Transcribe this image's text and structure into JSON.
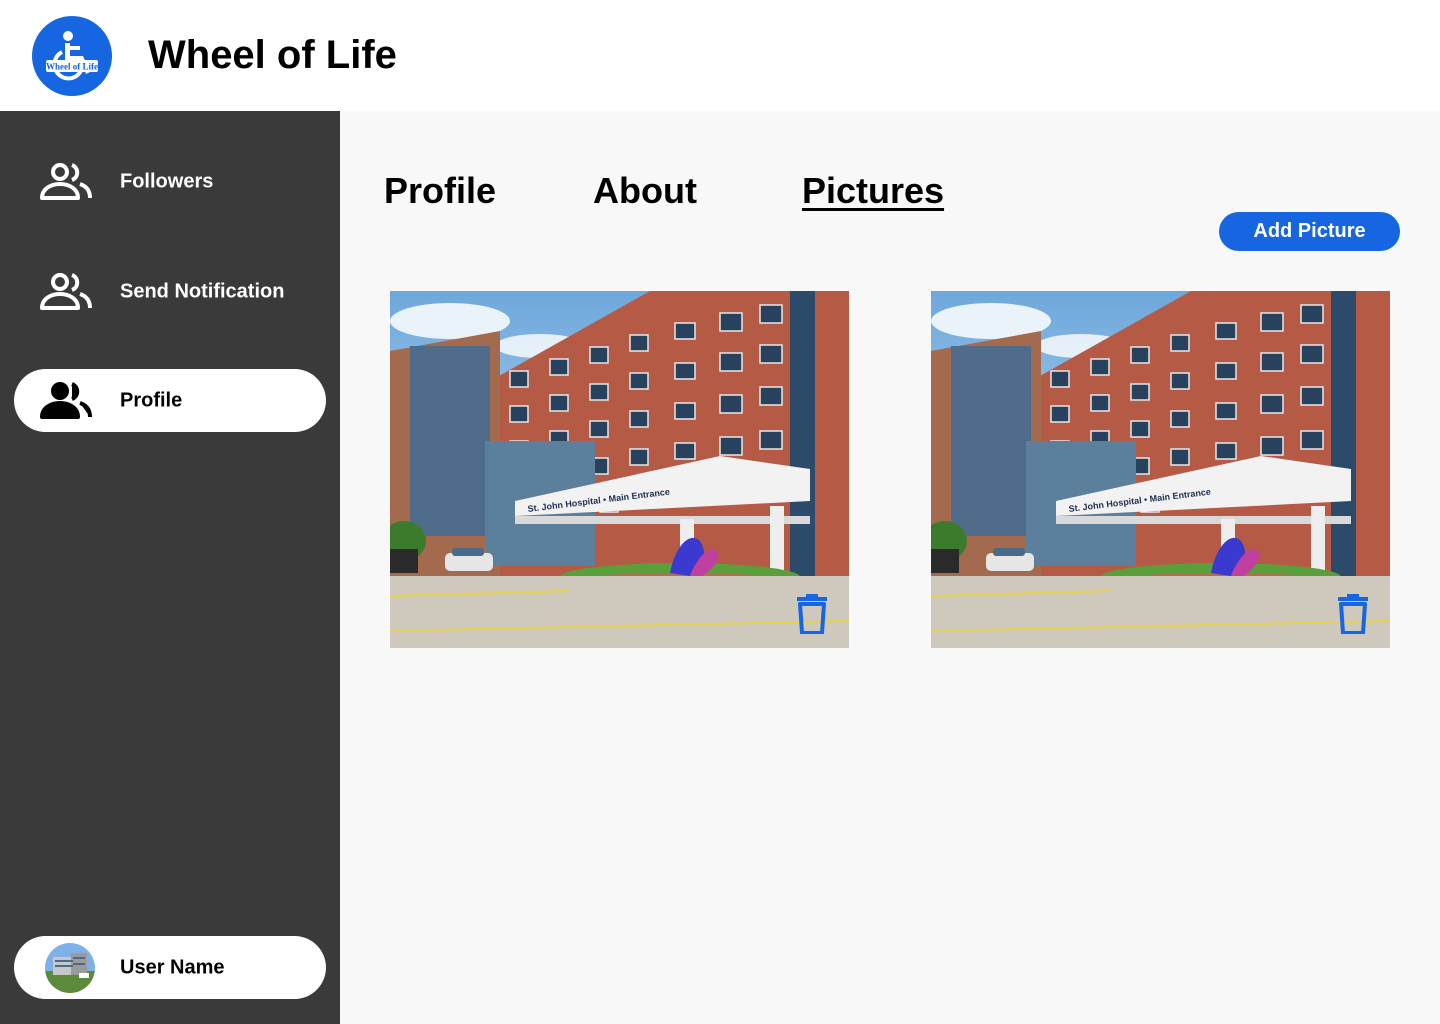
{
  "app": {
    "title": "Wheel of Life",
    "logo_text": "Wheel of Life",
    "logo_icon": "wheelchair-icon",
    "brand_color": "#1566e0"
  },
  "sidebar": {
    "items": [
      {
        "label": "Followers",
        "icon": "people-icon",
        "active": false
      },
      {
        "label": "Send Notification",
        "icon": "people-icon",
        "active": false
      },
      {
        "label": "Profile",
        "icon": "people-icon",
        "active": true
      }
    ],
    "user": {
      "name": "User Name"
    }
  },
  "tabs": [
    {
      "label": "Profile",
      "active": false
    },
    {
      "label": "About",
      "active": false
    },
    {
      "label": "Pictures",
      "active": true
    }
  ],
  "actions": {
    "add_picture": "Add Picture"
  },
  "pictures": [
    {
      "sign_text": "St. John Hospital • Main Entrance",
      "delete_icon": "trash-icon"
    },
    {
      "sign_text": "St. John Hospital • Main Entrance",
      "delete_icon": "trash-icon"
    }
  ]
}
